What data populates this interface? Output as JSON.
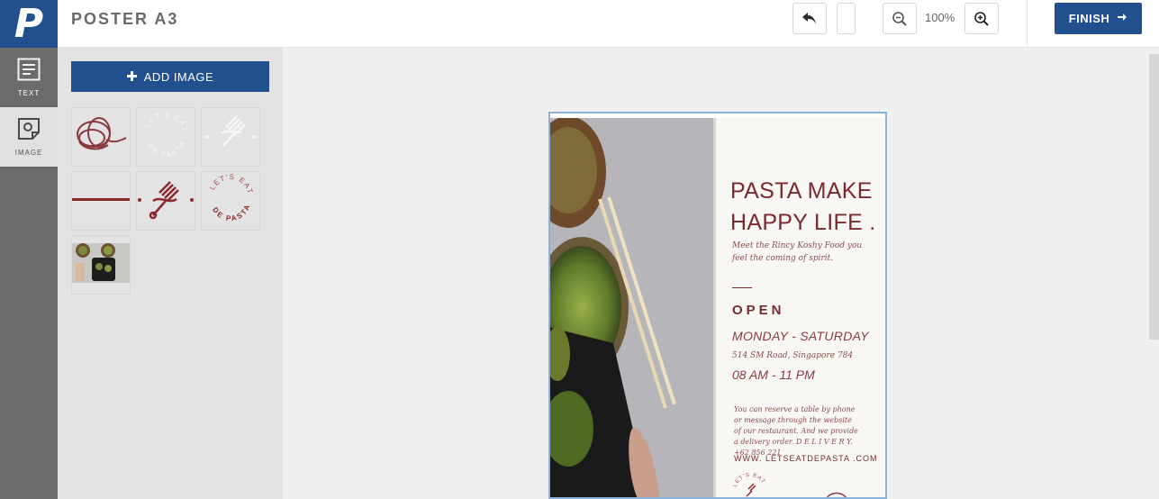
{
  "app": {
    "logo_letter": "P",
    "title": "POSTER A3"
  },
  "toolbar": {
    "zoom_level": "100%",
    "finish_label": "FINISH"
  },
  "rail": {
    "items": [
      {
        "label": "TEXT",
        "icon": "text-icon"
      },
      {
        "label": "IMAGE",
        "icon": "image-icon"
      }
    ]
  },
  "panel": {
    "add_image_label": "ADD IMAGE",
    "thumbnail_lettering": {
      "lets_eat": "LET'S EAT",
      "de_pasta": "DE PASTA"
    }
  },
  "poster": {
    "headline_line1": "PASTA MAKE",
    "headline_line2": "HAPPY LIFE .",
    "tagline": "Meet the Rincy Koshy Food  you feel the coming of spirit.",
    "open": "OPEN",
    "days": "MONDAY - SATURDAY",
    "address": "514 SM Road, Singapore 784",
    "hours": "08 AM - 11 PM",
    "note": "You can reserve a table by phone or message through the website of our restaurant. And we provide a delivery order. D E L I V E R Y. +62 856 221",
    "website": "WWW. LETSEATDEPASTA .COM"
  },
  "colors": {
    "brand_blue": "#22508f",
    "accent_maroon": "#7a2a2e",
    "selection_blue": "#8ab0dc"
  }
}
